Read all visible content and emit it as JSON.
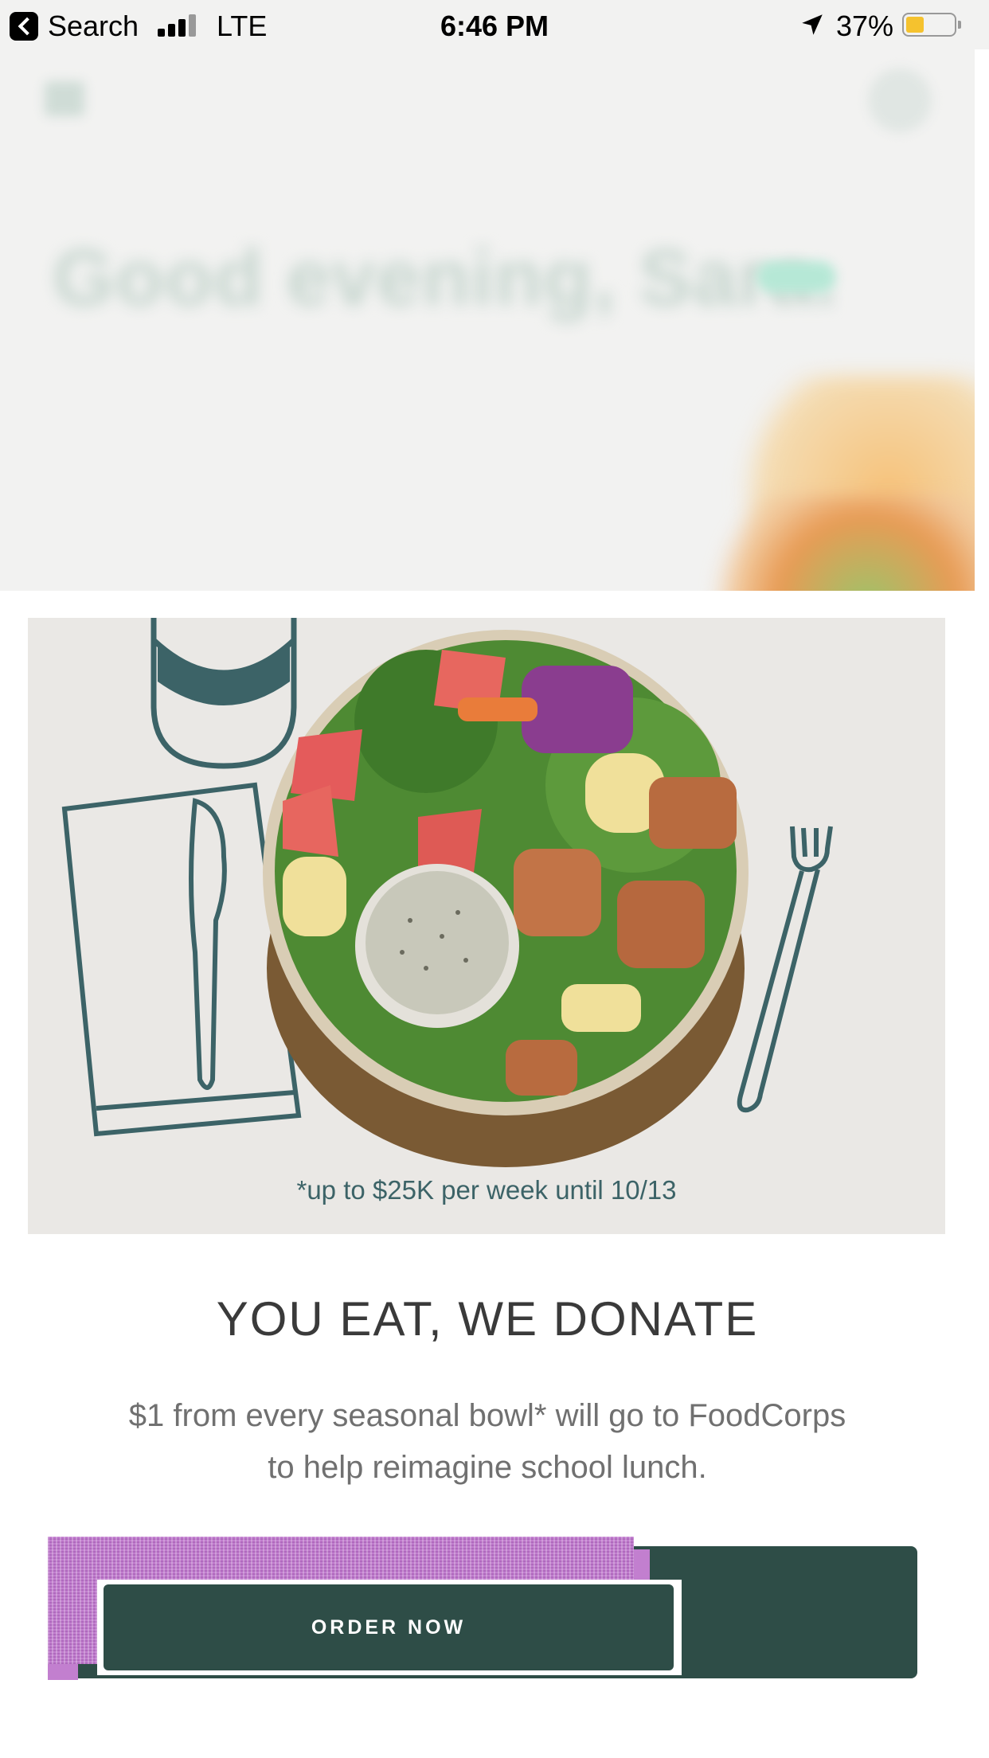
{
  "status_bar": {
    "back_label": "Search",
    "network": "LTE",
    "time": "6:46 PM",
    "battery_percent": "37%",
    "battery_level": 0.37,
    "battery_color": "#f5c22e"
  },
  "background_app": {
    "greeting": "Good evening, Sara."
  },
  "promo": {
    "footnote": "*up to $25K per week until 10/13",
    "headline": "YOU EAT, WE DONATE",
    "body_line1": "$1 from every seasonal bowl* will go to FoodCorps",
    "body_line2": "to help reimagine school lunch.",
    "cta_label": "ORDER NOW"
  },
  "colors": {
    "brand_dark_green": "#2e4d47",
    "illustration_teal": "#3c6367",
    "hero_background": "#eae8e5"
  },
  "icons": [
    "back-arrow-icon",
    "signal-bars-icon",
    "location-arrow-icon",
    "battery-icon",
    "menu-icon",
    "account-icon"
  ]
}
